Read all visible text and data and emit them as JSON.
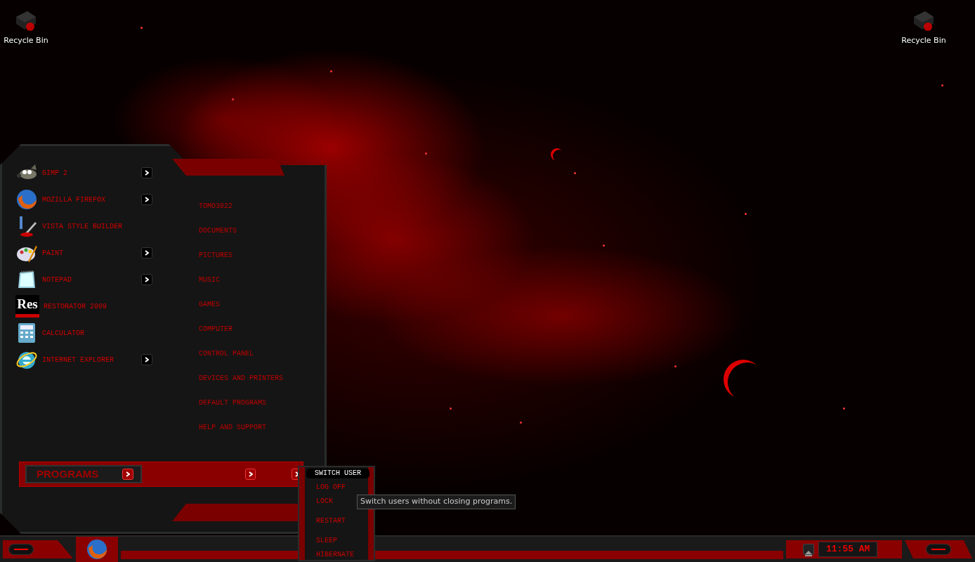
{
  "desktop_icons": [
    {
      "label": "Recycle Bin"
    },
    {
      "label": "Recycle Bin"
    }
  ],
  "start_menu": {
    "programs": [
      {
        "label": "GIMP 2",
        "has_submenu": true
      },
      {
        "label": "MOZILLA FIREFOX",
        "has_submenu": true
      },
      {
        "label": "VISTA STYLE BUILDER",
        "has_submenu": false
      },
      {
        "label": "PAINT",
        "has_submenu": true
      },
      {
        "label": "NOTEPAD",
        "has_submenu": true
      },
      {
        "label": "RESTORATOR 2009",
        "has_submenu": false,
        "icon_text": "Res"
      },
      {
        "label": "CALCULATOR",
        "has_submenu": false
      },
      {
        "label": "INTERNET EXPLORER",
        "has_submenu": true
      }
    ],
    "places": [
      "TOMO3022",
      "DOCUMENTS",
      "PICTURES",
      "MUSIC",
      "GAMES",
      "COMPUTER",
      "CONTROL PANEL",
      "DEVICES AND PRINTERS",
      "DEFAULT PROGRAMS",
      "HELP AND SUPPORT"
    ],
    "all_programs": "PROGRAMS",
    "power_menu": [
      {
        "label": "SWITCH USER",
        "selected": true
      },
      {
        "label": "LOG OFF",
        "selected": false
      },
      {
        "label": "LOCK",
        "selected": false
      },
      {
        "label": "RESTART",
        "selected": false
      },
      {
        "label": "SLEEP",
        "selected": false
      },
      {
        "label": "HIBERNATE",
        "selected": false
      }
    ],
    "tooltip": "Switch users without closing programs."
  },
  "taskbar": {
    "clock": "11:55 AM"
  }
}
